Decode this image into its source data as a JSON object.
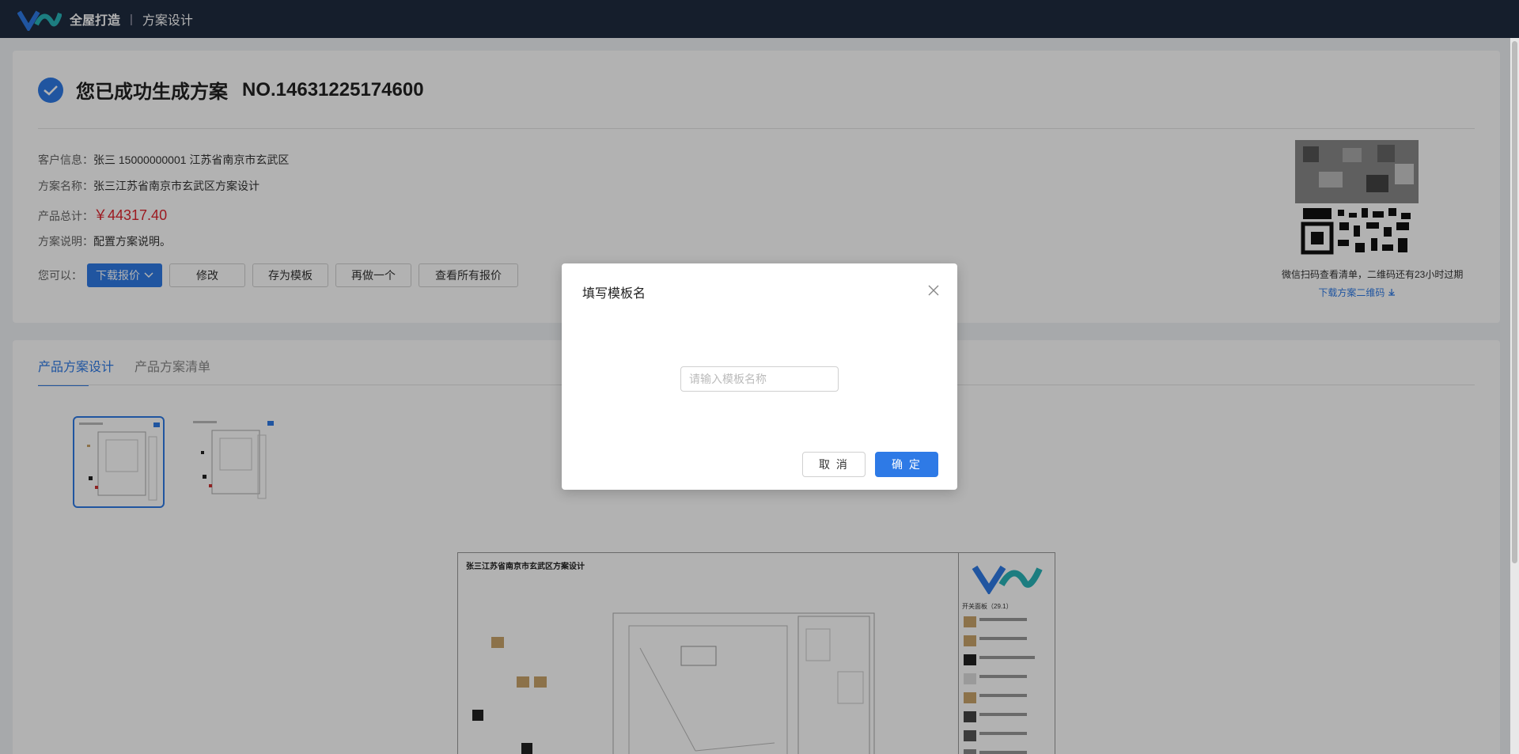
{
  "header": {
    "brand": "全屋打造",
    "separator": "|",
    "page": "方案设计"
  },
  "summary": {
    "title": "您已成功生成方案",
    "plan_no": "NO.14631225174600",
    "customer_label": "客户信息：",
    "customer_value": "张三  15000000001  江苏省南京市玄武区",
    "name_label": "方案名称：",
    "name_value": "张三江苏省南京市玄武区方案设计",
    "total_label": "产品总计：",
    "total_value": "￥44317.40",
    "desc_label": "方案说明：",
    "desc_value": "配置方案说明。"
  },
  "actions": {
    "label": "您可以：",
    "download_quote": "下载报价",
    "modify": "修改",
    "save_template": "存为模板",
    "redo": "再做一个",
    "view_quotes": "查看所有报价"
  },
  "qr": {
    "caption": "微信扫码查看清单，二维码还有23小时过期",
    "download_link": "下载方案二维码"
  },
  "tabs": [
    {
      "label": "产品方案设计",
      "active": true
    },
    {
      "label": "产品方案清单",
      "active": false
    }
  ],
  "plan": {
    "title": "张三江苏省南京市玄武区方案设计",
    "section": "开关面板（29.1）"
  },
  "modal": {
    "title": "填写模板名",
    "input_placeholder": "请输入模板名称",
    "input_value": "",
    "cancel": "取 消",
    "confirm": "确 定"
  },
  "colors": {
    "accent": "#2e7ae6",
    "nav_bg": "#1f2b40",
    "price": "#e0262f"
  }
}
